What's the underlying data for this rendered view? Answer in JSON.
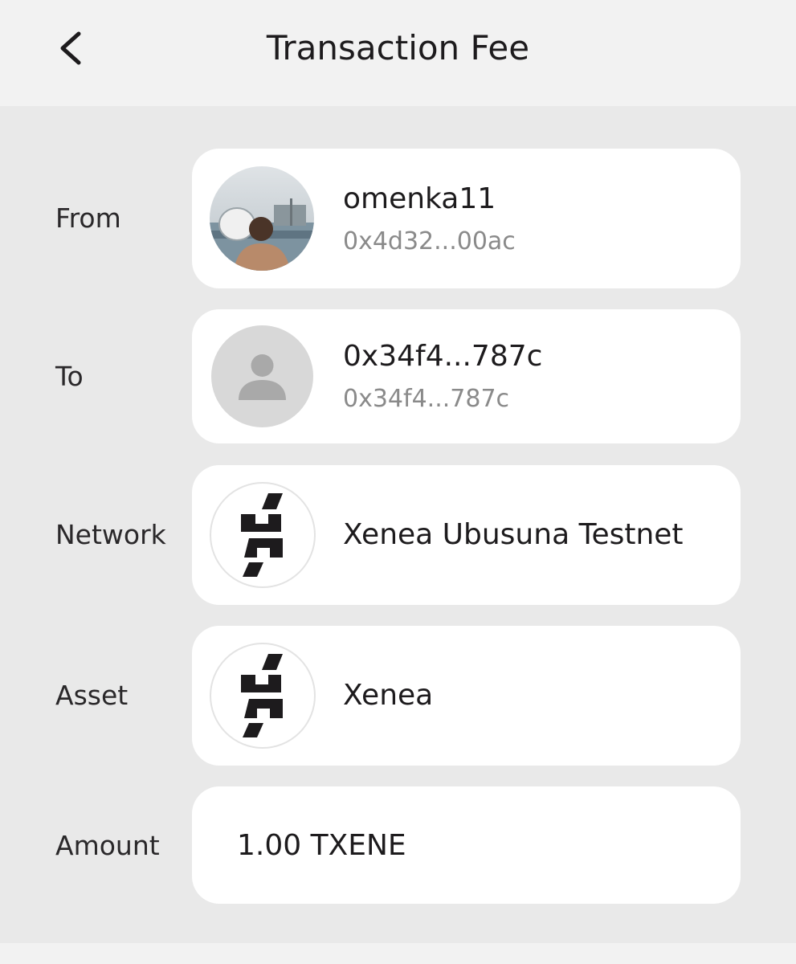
{
  "header": {
    "title": "Transaction Fee",
    "back_icon": "chevron-left-icon"
  },
  "from": {
    "label": "From",
    "name": "omenka11",
    "address": "0x4d32...00ac",
    "avatar": "user-photo"
  },
  "to": {
    "label": "To",
    "name": "0x34f4...787c",
    "address": "0x34f4...787c",
    "avatar": "default-user-icon"
  },
  "network": {
    "label": "Network",
    "name": "Xenea Ubusuna Testnet",
    "icon": "xenea-logo-icon"
  },
  "asset": {
    "label": "Asset",
    "name": "Xenea",
    "icon": "xenea-logo-icon"
  },
  "amount": {
    "label": "Amount",
    "value": "1.00 TXENE"
  },
  "colors": {
    "background": "#e9e9e9",
    "header_background": "#f2f2f2",
    "card_background": "#ffffff",
    "primary_text": "#1d1b1d",
    "secondary_text": "#8a8a8a"
  }
}
